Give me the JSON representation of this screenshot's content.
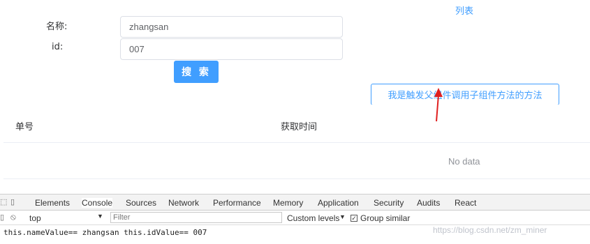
{
  "form": {
    "name_label": "名称:",
    "id_label": "id:",
    "name_value": "zhangsan",
    "id_value": "007",
    "search_label": "搜 索"
  },
  "nav": {
    "list_link": "列表"
  },
  "parent_button": "我是触发父组件调用子组件方法的方法",
  "table": {
    "columns": [
      "单号",
      "获取时间"
    ],
    "empty_text": "No data"
  },
  "devtools": {
    "tabs": [
      "Elements",
      "Console",
      "Sources",
      "Network",
      "Performance",
      "Memory",
      "Application",
      "Security",
      "Audits",
      "React"
    ],
    "active_tab": "Console",
    "context": "top",
    "filter_placeholder": "Filter",
    "levels": "Custom levels",
    "group_similar": "Group similar",
    "log_line": "this.nameValue== zhangsan this.idValue== 007"
  },
  "watermark": "https://blog.csdn.net/zm_miner",
  "colors": {
    "primary": "#409eff",
    "arrow": "#e02020"
  }
}
